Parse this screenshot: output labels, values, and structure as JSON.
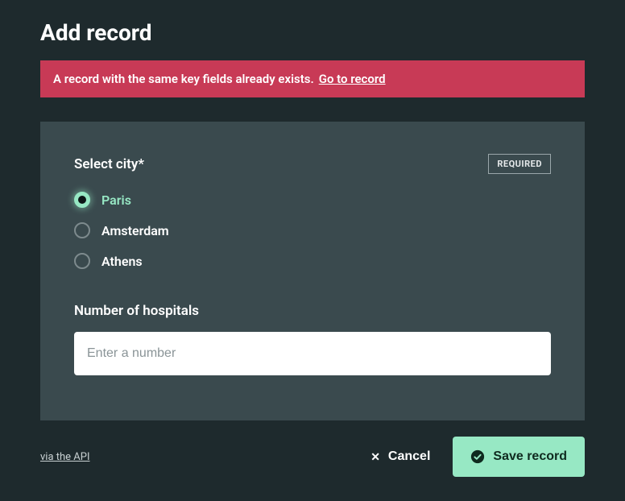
{
  "page": {
    "title": "Add record"
  },
  "error": {
    "message": "A record with the same key fields already exists.",
    "link_text": "Go to record"
  },
  "form": {
    "city": {
      "label": "Select city*",
      "required_badge": "REQUIRED",
      "options": [
        {
          "label": "Paris",
          "selected": true
        },
        {
          "label": "Amsterdam",
          "selected": false
        },
        {
          "label": "Athens",
          "selected": false
        }
      ]
    },
    "hospitals": {
      "label": "Number of hospitals",
      "placeholder": "Enter a number",
      "value": ""
    }
  },
  "footer": {
    "api_link": "via the API",
    "cancel": "Cancel",
    "save": "Save record"
  }
}
